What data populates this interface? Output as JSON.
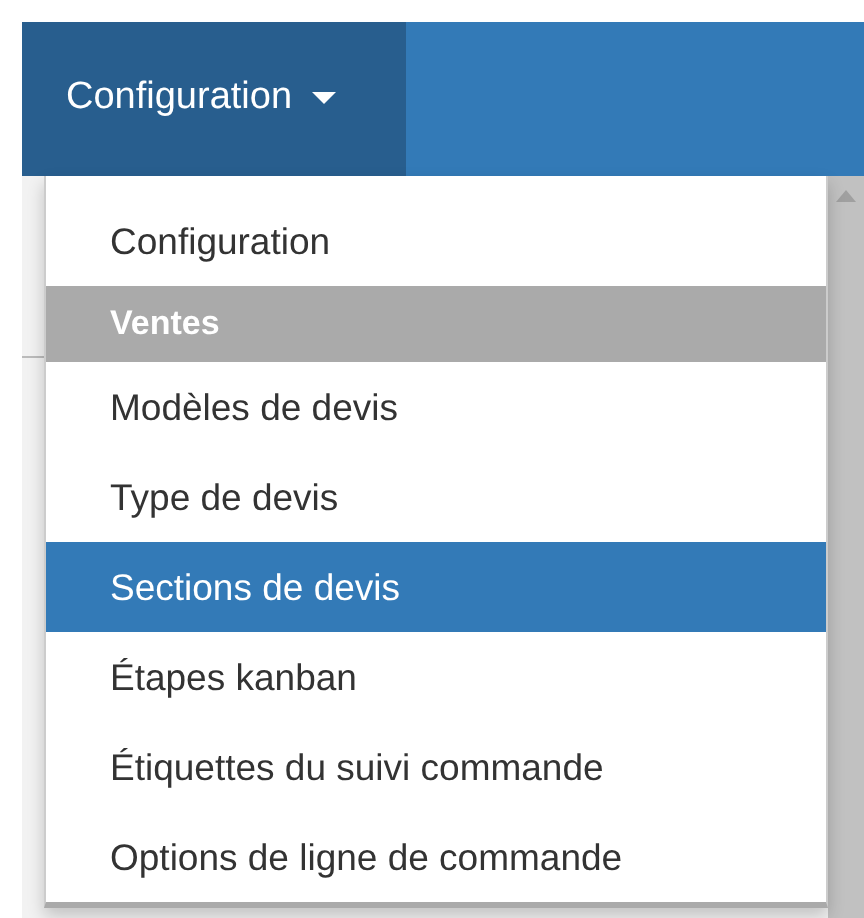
{
  "navbar": {
    "menu": {
      "label": "Configuration",
      "expanded": true
    }
  },
  "dropdown": {
    "items": [
      {
        "kind": "item",
        "label": "Configuration",
        "selected": false
      },
      {
        "kind": "header",
        "label": "Ventes"
      },
      {
        "kind": "item",
        "label": "Modèles de devis",
        "selected": false
      },
      {
        "kind": "item",
        "label": "Type de devis",
        "selected": false
      },
      {
        "kind": "item",
        "label": "Sections de devis",
        "selected": true
      },
      {
        "kind": "item",
        "label": "Étapes kanban",
        "selected": false
      },
      {
        "kind": "item",
        "label": "Étiquettes du suivi commande",
        "selected": false
      },
      {
        "kind": "item",
        "label": "Options de ligne de commande",
        "selected": false
      }
    ]
  }
}
